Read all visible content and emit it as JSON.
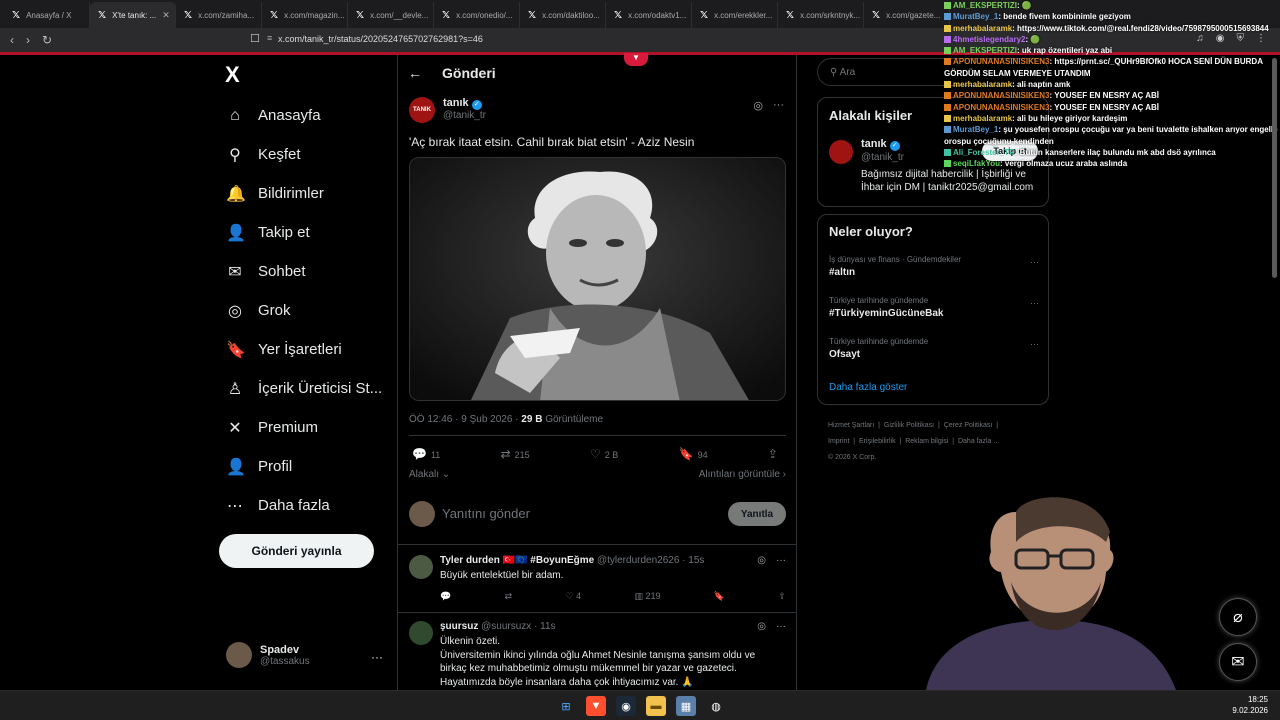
{
  "browser": {
    "tabs": [
      {
        "label": "Anasayfa / X",
        "active": false
      },
      {
        "label": "X'te tanık: ...",
        "active": true
      },
      {
        "label": "x.com/zamiha...",
        "active": false
      },
      {
        "label": "x.com/magazin...",
        "active": false
      },
      {
        "label": "x.com/__devle...",
        "active": false
      },
      {
        "label": "x.com/onedio/...",
        "active": false
      },
      {
        "label": "x.com/daktiloo...",
        "active": false
      },
      {
        "label": "x.com/odaktv1...",
        "active": false
      },
      {
        "label": "x.com/erekkler...",
        "active": false
      },
      {
        "label": "x.com/srkntnyk...",
        "active": false
      },
      {
        "label": "x.com/gazete...",
        "active": false
      }
    ],
    "url": "x.com/tanik_tr/status/2020524765702762981?s=46"
  },
  "sidebar": {
    "logo": "X",
    "items": [
      {
        "label": "Anasayfa",
        "icon": "home-icon",
        "glyph": "⌂"
      },
      {
        "label": "Keşfet",
        "icon": "search-icon",
        "glyph": "⚲"
      },
      {
        "label": "Bildirimler",
        "icon": "bell-icon",
        "glyph": "🔔"
      },
      {
        "label": "Takip et",
        "icon": "person-add-icon",
        "glyph": "👤"
      },
      {
        "label": "Sohbet",
        "icon": "mail-icon",
        "glyph": "✉"
      },
      {
        "label": "Grok",
        "icon": "grok-icon",
        "glyph": "◎"
      },
      {
        "label": "Yer İşaretleri",
        "icon": "bookmark-icon",
        "glyph": "🔖"
      },
      {
        "label": "İçerik Üreticisi St...",
        "icon": "creator-icon",
        "glyph": "♙"
      },
      {
        "label": "Premium",
        "icon": "x-icon",
        "glyph": "✕"
      },
      {
        "label": "Profil",
        "icon": "profile-icon",
        "glyph": "👤"
      },
      {
        "label": "Daha fazla",
        "icon": "more-circle-icon",
        "glyph": "⋯"
      }
    ],
    "post_button": "Gönderi yayınla",
    "account": {
      "name": "Spadev",
      "handle": "@tassakus",
      "more": "···"
    }
  },
  "post": {
    "header": "Gönderi",
    "author": {
      "name": "tanık",
      "handle": "@tanik_tr",
      "avatar_text": "TANIK"
    },
    "text": "'Aç bırak itaat etsin. Cahil bırak biat etsin' - Aziz Nesin",
    "time": "ÖÖ 12:46 · 9 Şub 2026 ·",
    "views": "29 B",
    "views_label": "Görüntüleme",
    "replies": "11",
    "reposts": "215",
    "likes": "2 B",
    "bookmarks": "94",
    "sort_left": "Alakalı ⌄",
    "sort_right": "Alıntıları görüntüle ›",
    "reply_placeholder": "Yanıtını gönder",
    "reply_button": "Yanıtla"
  },
  "replies": [
    {
      "name": "Tyler durden 🇹🇷🇪🇺 #BoyunEğme",
      "handle": "@tylerdurden2626 · 15s",
      "text": "Büyük entelektüel bir adam.",
      "likes": "4",
      "views": "219"
    },
    {
      "name": "şuursuz",
      "handle": "@suursuzx · 11s",
      "text_lines": [
        "Ülkenin özeti.",
        "Üniversitemin ikinci yılında oğlu Ahmet Nesinle tanışma şansım oldu ve birkaç kez muhabbetimiz olmuştu mükemmel bir yazar ve gazeteci.",
        "Hayatımızda böyle insanlara daha çok ihtiyacımız var. 🙏"
      ]
    }
  ],
  "right": {
    "search_placeholder": "Ara",
    "related_title": "Alakalı kişiler",
    "related": {
      "name": "tanık",
      "handle": "@tanik_tr",
      "bio": "Bağımsız dijital habercilik | İşbirliği ve İhbar için DM | taniktr2025@gmail.com",
      "follow": "Takip et"
    },
    "trends_title": "Neler oluyor?",
    "trends": [
      {
        "category": "İş dünyası ve finans · Gündemdekiler",
        "name": "#altın"
      },
      {
        "category": "Türkiye tarihinde gündemde",
        "name": "#TürkiyeminGücüneBak"
      },
      {
        "category": "Türkiye tarihinde gündemde",
        "name": "Ofsayt"
      }
    ],
    "more": "Daha fazla göster",
    "footer": [
      "Hizmet Şartları",
      "Gizlilik Politikası",
      "Çerez Politikası",
      "Imprint",
      "Erişilebilirlik",
      "Reklam bilgisi",
      "Daha fazla ...",
      "© 2026 X Corp."
    ]
  },
  "chat": [
    {
      "user": "AM_EKSPERTIZI",
      "color": "#7cd15a",
      "msg": ": 🟢"
    },
    {
      "user": "MuratBey_1",
      "color": "#5b9bd5",
      "msg": ": bende fivem kombinimle geziyom"
    },
    {
      "user": "merhabalaramk",
      "color": "#e8c547",
      "msg": ": https://www.tiktok.com/@real.fendi28/video/7598795000515693844"
    },
    {
      "user": "4hmetislegendary2",
      "color": "#b86cf2",
      "msg": ": 🟢"
    },
    {
      "user": "AM_EKSPERTIZI",
      "color": "#7cd15a",
      "msg": ": uk rap özentileri yaz abi"
    },
    {
      "user": "APONUNANASINISIKEN3",
      "color": "#e07a1f",
      "msg": ": https://prnt.sc/_QUHr9BfOfk0 HOCA SENİ DÜN BURDA GÖRDÜM SELAM VERMEYE UTANDIM"
    },
    {
      "user": "merhabalaramk",
      "color": "#e8c547",
      "msg": ": ali naptın amk"
    },
    {
      "user": "APONUNANASINISIKEN3",
      "color": "#e07a1f",
      "msg": ": YOUSEF EN NESRY AÇ ABİ"
    },
    {
      "user": "APONUNANASINISIKEN3",
      "color": "#e07a1f",
      "msg": ": YOUSEF EN NESRY AÇ ABİ"
    },
    {
      "user": "merhabalaramk",
      "color": "#e8c547",
      "msg": ": ali bu hileye giriyor kardeşim"
    },
    {
      "user": "MuratBey_1",
      "color": "#5b9bd5",
      "msg": ": şu yousefen orospu çocuğu var ya beni tuvalette ishalken arıyor engelle orospu çocuğunu kendinden"
    },
    {
      "user": "Ali_Forester_TR",
      "color": "#3fc3a2",
      "msg": ": Bütün kanserlere ilaç bulundu mk abd dsö ayrılınca"
    },
    {
      "user": "seqiLfakYou",
      "color": "#5cd65c",
      "msg": ": vergi olmaza ucuz araba aslında"
    }
  ],
  "taskbar": {
    "time": "18:25",
    "date": "9.02.2026"
  }
}
